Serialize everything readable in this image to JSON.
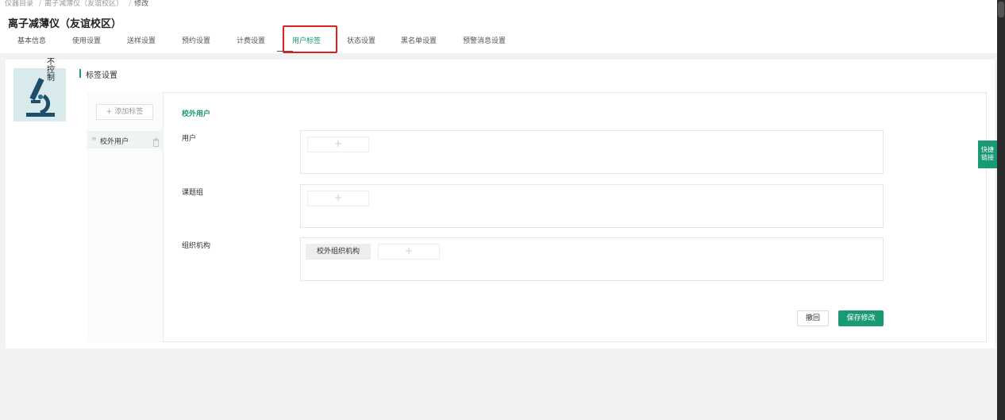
{
  "breadcrumb": {
    "items": [
      "仪器目录",
      "离子减薄仪（友谊校区）",
      "修改"
    ]
  },
  "page": {
    "title": "离子减薄仪（友谊校区）"
  },
  "tabs": [
    {
      "label": "基本信息"
    },
    {
      "label": "使用设置"
    },
    {
      "label": "送样设置"
    },
    {
      "label": "预约设置"
    },
    {
      "label": "计费设置"
    },
    {
      "label": "用户标签",
      "active": true
    },
    {
      "label": "状态设置"
    },
    {
      "label": "黑名单设置"
    },
    {
      "label": "预警消息设置"
    }
  ],
  "instrument": {
    "status_text": "不控制",
    "icon": "microscope-icon"
  },
  "section": {
    "title": "标签设置"
  },
  "tag_sidebar": {
    "add_label": "+ 添加标签",
    "items": [
      {
        "label": "校外用户"
      }
    ]
  },
  "tag_detail": {
    "group_title": "校外用户",
    "fields": [
      {
        "label": "用户",
        "chips": []
      },
      {
        "label": "课题组",
        "chips": []
      },
      {
        "label": "组织机构",
        "chips": [
          "校外组织机构"
        ]
      }
    ],
    "add_glyph": "+"
  },
  "actions": {
    "back_label": "撤回",
    "save_label": "保存修改"
  },
  "quick_link": {
    "line1": "快捷",
    "line2": "链接"
  },
  "colors": {
    "accent": "#1a9a74",
    "highlight_border": "#e02020"
  }
}
